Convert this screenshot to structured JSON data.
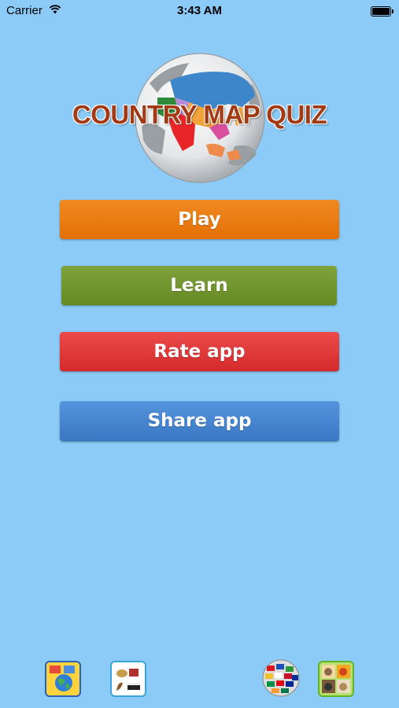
{
  "status_bar": {
    "carrier": "Carrier",
    "time": "3:43 AM"
  },
  "header": {
    "title": "COUNTRY MAP QUIZ"
  },
  "menu": {
    "play": "Play",
    "learn": "Learn",
    "rate": "Rate app",
    "share": "Share app"
  },
  "colors": {
    "background": "#8ccbf7",
    "play": "#ec7d12",
    "learn": "#729632",
    "rate": "#e03a3b",
    "share": "#4886d0",
    "title": "#a33a16"
  },
  "bottom_apps": [
    {
      "icon": "world-quiz-app-icon"
    },
    {
      "icon": "instruments-app-icon"
    },
    {
      "icon": "flags-globe-app-icon"
    },
    {
      "icon": "animals-app-icon"
    }
  ]
}
